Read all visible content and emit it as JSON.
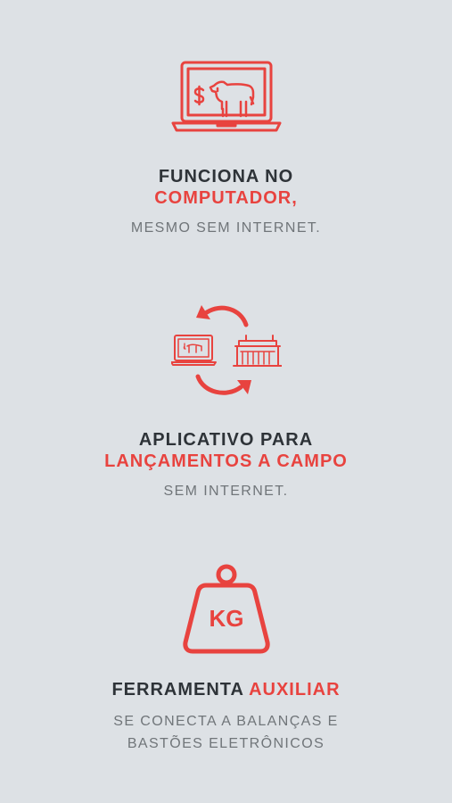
{
  "colors": {
    "accent": "#e8433f",
    "dark": "#2e3338",
    "muted": "#707579",
    "background": "#dde1e5"
  },
  "icons": [
    "laptop-cattle-icon",
    "sync-arrows-icon",
    "weight-kg-icon"
  ],
  "features": [
    {
      "title_line1": "FUNCIONA NO",
      "title_line2": "COMPUTADOR,",
      "subtitle": "MESMO SEM INTERNET."
    },
    {
      "title_line1": "APLICATIVO PARA",
      "title_line2": "LANÇAMENTOS A CAMPO",
      "subtitle": "SEM INTERNET."
    },
    {
      "title_plain": "FERRAMENTA",
      "title_accent": "AUXILIAR",
      "subtitle_line1": "SE CONECTA A BALANÇAS E",
      "subtitle_line2": "BASTÕES ELETRÔNICOS",
      "weight_label": "KG"
    }
  ]
}
